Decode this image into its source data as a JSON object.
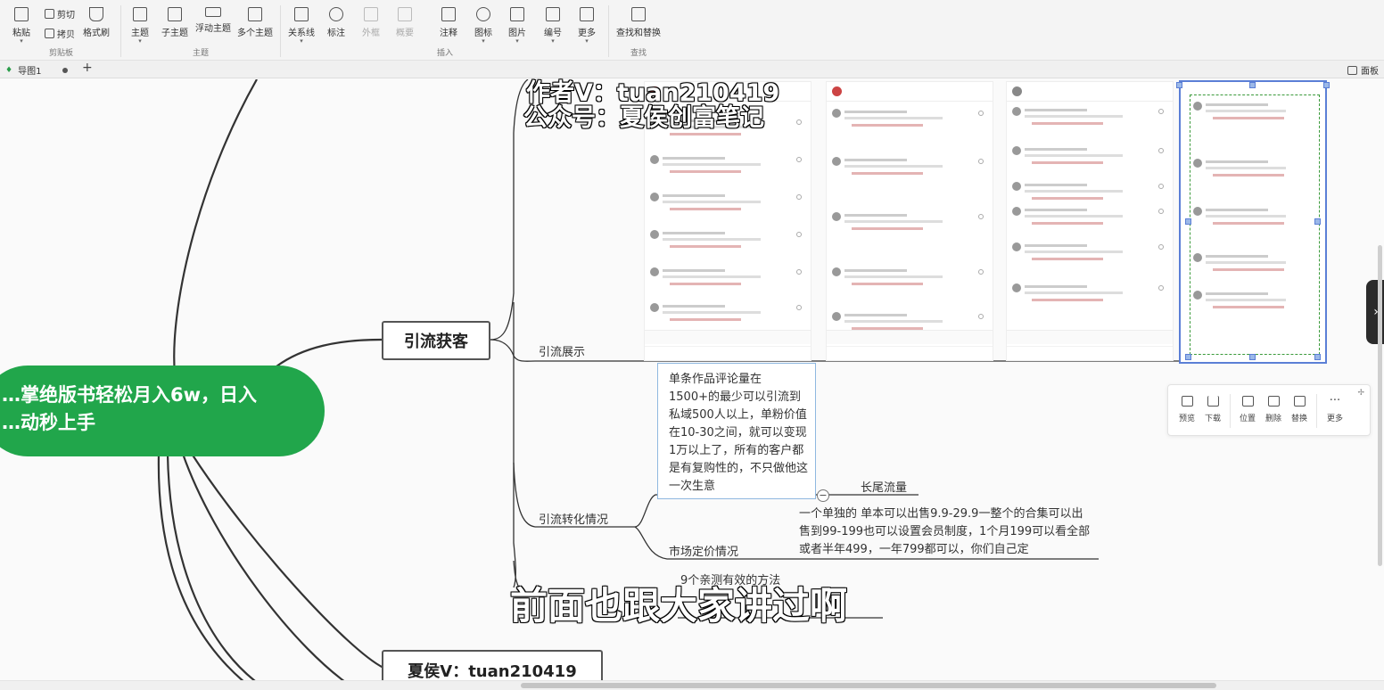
{
  "ribbon": {
    "clipboard": {
      "paste": "粘贴",
      "cut": "剪切",
      "copy": "拷贝",
      "format_painter": "格式刷",
      "group": "剪贴板"
    },
    "topic": {
      "topic": "主题",
      "subtopic": "子主题",
      "floating": "浮动主题",
      "multiple": "多个主题",
      "group": "主题"
    },
    "insert": {
      "relationship": "关系线",
      "callout": "标注",
      "boundary": "外框",
      "summary": "概要",
      "note": "注释",
      "marker": "图标",
      "image": "图片",
      "numbering": "编号",
      "more": "更多",
      "group": "插入"
    },
    "find": {
      "find_replace": "查找和替换",
      "group": "查找"
    }
  },
  "tabs": {
    "doc_tab": "导图1",
    "add": "+",
    "panel": "面板"
  },
  "mindmap": {
    "central": {
      "line1": "…掌绝版书轻松月入6w，日入",
      "line2": "…动秒上手"
    },
    "branch_traffic": "引流获客",
    "branch_contact": "夏侯V：tuan210419",
    "label_showcase": "引流展示",
    "label_conversion": "引流转化情况",
    "label_pricing": "市场定价情况",
    "label_longtail": "长尾流量",
    "label_methods": "9个亲测有效的方法",
    "note": "单条作品评论量在1500+的最少可以引流到私域500人以上，单粉价值在10-30之间，就可以变现1万以上了，所有的客户都是有复购性的，不只做他这一次生意",
    "pricing": "一个单独的 单本可以出售9.9-29.9一整个的合集可以出售到99-199也可以设置会员制度，1个月199可以看全部或者半年499，一年799都可以，你们自己定"
  },
  "image_toolbar": {
    "preview": "预览",
    "download": "下载",
    "position": "位置",
    "delete": "删除",
    "replace": "替换",
    "more": "更多"
  },
  "overlay": {
    "watermark_line1": "作者V：tuan210419",
    "watermark_line2": "公众号：夏侯创富笔记",
    "subtitle": "前面也跟大家讲过啊"
  },
  "colors": {
    "central": "#21a64b",
    "selection": "#5b7fd6",
    "dashed_frame": "#3a9a3a"
  }
}
